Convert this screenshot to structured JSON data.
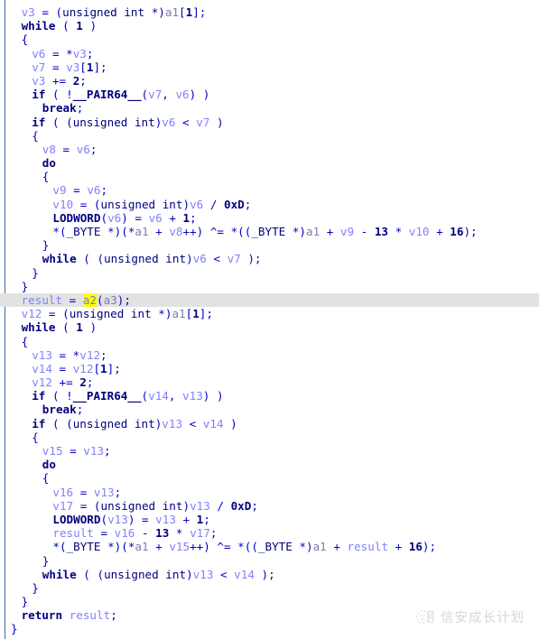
{
  "window": {
    "view_name": "Pseudocode",
    "language": "C"
  },
  "highlight": {
    "selected_token": "a2",
    "selected_line_index": 22,
    "selection_color": "#ffff00",
    "line_color": "#e2e2e2",
    "gutter_rule_color": "#3a6ea5"
  },
  "watermark": {
    "text": "信安成长计划",
    "logo_name": "circular-book-logo"
  },
  "code": {
    "lines": [
      {
        "indent": 1,
        "tokens": [
          {
            "t": "var",
            "v": "v3"
          },
          {
            "t": "punct",
            "v": " = ("
          },
          {
            "t": "type",
            "v": "unsigned int"
          },
          {
            "t": "punct",
            "v": " *)"
          },
          {
            "t": "arg",
            "v": "a1"
          },
          {
            "t": "punct",
            "v": "["
          },
          {
            "t": "num",
            "v": "1"
          },
          {
            "t": "punct",
            "v": "];"
          }
        ]
      },
      {
        "indent": 1,
        "tokens": [
          {
            "t": "kw",
            "v": "while"
          },
          {
            "t": "punct",
            "v": " ( "
          },
          {
            "t": "num",
            "v": "1"
          },
          {
            "t": "punct",
            "v": " )"
          }
        ]
      },
      {
        "indent": 1,
        "tokens": [
          {
            "t": "brace",
            "v": "{"
          }
        ]
      },
      {
        "indent": 2,
        "tokens": [
          {
            "t": "var",
            "v": "v6"
          },
          {
            "t": "punct",
            "v": " = *"
          },
          {
            "t": "var",
            "v": "v3"
          },
          {
            "t": "punct",
            "v": ";"
          }
        ]
      },
      {
        "indent": 2,
        "tokens": [
          {
            "t": "var",
            "v": "v7"
          },
          {
            "t": "punct",
            "v": " = "
          },
          {
            "t": "var",
            "v": "v3"
          },
          {
            "t": "punct",
            "v": "["
          },
          {
            "t": "num",
            "v": "1"
          },
          {
            "t": "punct",
            "v": "];"
          }
        ]
      },
      {
        "indent": 2,
        "tokens": [
          {
            "t": "var",
            "v": "v3"
          },
          {
            "t": "punct",
            "v": " += "
          },
          {
            "t": "num",
            "v": "2"
          },
          {
            "t": "punct",
            "v": ";"
          }
        ]
      },
      {
        "indent": 2,
        "tokens": [
          {
            "t": "kw",
            "v": "if"
          },
          {
            "t": "punct",
            "v": " ( !"
          },
          {
            "t": "func",
            "v": "__PAIR64__"
          },
          {
            "t": "punct",
            "v": "("
          },
          {
            "t": "var",
            "v": "v7"
          },
          {
            "t": "punct",
            "v": ", "
          },
          {
            "t": "var",
            "v": "v6"
          },
          {
            "t": "punct",
            "v": ") )"
          }
        ]
      },
      {
        "indent": 3,
        "tokens": [
          {
            "t": "kw",
            "v": "break"
          },
          {
            "t": "punct",
            "v": ";"
          }
        ]
      },
      {
        "indent": 2,
        "tokens": [
          {
            "t": "kw",
            "v": "if"
          },
          {
            "t": "punct",
            "v": " ( ("
          },
          {
            "t": "type",
            "v": "unsigned int"
          },
          {
            "t": "punct",
            "v": ")"
          },
          {
            "t": "var",
            "v": "v6"
          },
          {
            "t": "punct",
            "v": " < "
          },
          {
            "t": "var",
            "v": "v7"
          },
          {
            "t": "punct",
            "v": " )"
          }
        ]
      },
      {
        "indent": 2,
        "tokens": [
          {
            "t": "brace",
            "v": "{"
          }
        ]
      },
      {
        "indent": 3,
        "tokens": [
          {
            "t": "var",
            "v": "v8"
          },
          {
            "t": "punct",
            "v": " = "
          },
          {
            "t": "var",
            "v": "v6"
          },
          {
            "t": "punct",
            "v": ";"
          }
        ]
      },
      {
        "indent": 3,
        "tokens": [
          {
            "t": "kw",
            "v": "do"
          }
        ]
      },
      {
        "indent": 3,
        "tokens": [
          {
            "t": "brace",
            "v": "{"
          }
        ]
      },
      {
        "indent": 4,
        "tokens": [
          {
            "t": "var",
            "v": "v9"
          },
          {
            "t": "punct",
            "v": " = "
          },
          {
            "t": "var",
            "v": "v6"
          },
          {
            "t": "punct",
            "v": ";"
          }
        ]
      },
      {
        "indent": 4,
        "tokens": [
          {
            "t": "var",
            "v": "v10"
          },
          {
            "t": "punct",
            "v": " = ("
          },
          {
            "t": "type",
            "v": "unsigned int"
          },
          {
            "t": "punct",
            "v": ")"
          },
          {
            "t": "var",
            "v": "v6"
          },
          {
            "t": "punct",
            "v": " / "
          },
          {
            "t": "num",
            "v": "0xD"
          },
          {
            "t": "punct",
            "v": ";"
          }
        ]
      },
      {
        "indent": 4,
        "tokens": [
          {
            "t": "func",
            "v": "LODWORD"
          },
          {
            "t": "punct",
            "v": "("
          },
          {
            "t": "var",
            "v": "v6"
          },
          {
            "t": "punct",
            "v": ") = "
          },
          {
            "t": "var",
            "v": "v6"
          },
          {
            "t": "punct",
            "v": " + "
          },
          {
            "t": "num",
            "v": "1"
          },
          {
            "t": "punct",
            "v": ";"
          }
        ]
      },
      {
        "indent": 4,
        "tokens": [
          {
            "t": "punct",
            "v": "*("
          },
          {
            "t": "type",
            "v": "_BYTE"
          },
          {
            "t": "punct",
            "v": " *)(*"
          },
          {
            "t": "arg",
            "v": "a1"
          },
          {
            "t": "punct",
            "v": " + "
          },
          {
            "t": "var",
            "v": "v8"
          },
          {
            "t": "punct",
            "v": "++) ^= *(("
          },
          {
            "t": "type",
            "v": "_BYTE"
          },
          {
            "t": "punct",
            "v": " *)"
          },
          {
            "t": "arg",
            "v": "a1"
          },
          {
            "t": "punct",
            "v": " + "
          },
          {
            "t": "var",
            "v": "v9"
          },
          {
            "t": "punct",
            "v": " - "
          },
          {
            "t": "num",
            "v": "13"
          },
          {
            "t": "punct",
            "v": " * "
          },
          {
            "t": "var",
            "v": "v10"
          },
          {
            "t": "punct",
            "v": " + "
          },
          {
            "t": "num",
            "v": "16"
          },
          {
            "t": "punct",
            "v": ");"
          }
        ]
      },
      {
        "indent": 3,
        "tokens": [
          {
            "t": "brace",
            "v": "}"
          }
        ]
      },
      {
        "indent": 3,
        "tokens": [
          {
            "t": "kw",
            "v": "while"
          },
          {
            "t": "punct",
            "v": " ( ("
          },
          {
            "t": "type",
            "v": "unsigned int"
          },
          {
            "t": "punct",
            "v": ")"
          },
          {
            "t": "var",
            "v": "v6"
          },
          {
            "t": "punct",
            "v": " < "
          },
          {
            "t": "var",
            "v": "v7"
          },
          {
            "t": "punct",
            "v": " );"
          }
        ]
      },
      {
        "indent": 2,
        "tokens": [
          {
            "t": "brace",
            "v": "}"
          }
        ]
      },
      {
        "indent": 1,
        "tokens": [
          {
            "t": "brace",
            "v": "}"
          }
        ]
      },
      {
        "indent": 1,
        "highlighted": true,
        "tokens": [
          {
            "t": "result",
            "v": "result"
          },
          {
            "t": "punct",
            "v": " = "
          },
          {
            "t": "hl",
            "v": "a2"
          },
          {
            "t": "punct",
            "v": "("
          },
          {
            "t": "arg",
            "v": "a3"
          },
          {
            "t": "punct",
            "v": ");"
          }
        ]
      },
      {
        "indent": 1,
        "tokens": [
          {
            "t": "var",
            "v": "v12"
          },
          {
            "t": "punct",
            "v": " = ("
          },
          {
            "t": "type",
            "v": "unsigned int"
          },
          {
            "t": "punct",
            "v": " *)"
          },
          {
            "t": "arg",
            "v": "a1"
          },
          {
            "t": "punct",
            "v": "["
          },
          {
            "t": "num",
            "v": "1"
          },
          {
            "t": "punct",
            "v": "];"
          }
        ]
      },
      {
        "indent": 1,
        "tokens": [
          {
            "t": "kw",
            "v": "while"
          },
          {
            "t": "punct",
            "v": " ( "
          },
          {
            "t": "num",
            "v": "1"
          },
          {
            "t": "punct",
            "v": " )"
          }
        ]
      },
      {
        "indent": 1,
        "tokens": [
          {
            "t": "brace",
            "v": "{"
          }
        ]
      },
      {
        "indent": 2,
        "tokens": [
          {
            "t": "var",
            "v": "v13"
          },
          {
            "t": "punct",
            "v": " = *"
          },
          {
            "t": "var",
            "v": "v12"
          },
          {
            "t": "punct",
            "v": ";"
          }
        ]
      },
      {
        "indent": 2,
        "tokens": [
          {
            "t": "var",
            "v": "v14"
          },
          {
            "t": "punct",
            "v": " = "
          },
          {
            "t": "var",
            "v": "v12"
          },
          {
            "t": "punct",
            "v": "["
          },
          {
            "t": "num",
            "v": "1"
          },
          {
            "t": "punct",
            "v": "];"
          }
        ]
      },
      {
        "indent": 2,
        "tokens": [
          {
            "t": "var",
            "v": "v12"
          },
          {
            "t": "punct",
            "v": " += "
          },
          {
            "t": "num",
            "v": "2"
          },
          {
            "t": "punct",
            "v": ";"
          }
        ]
      },
      {
        "indent": 2,
        "tokens": [
          {
            "t": "kw",
            "v": "if"
          },
          {
            "t": "punct",
            "v": " ( !"
          },
          {
            "t": "func",
            "v": "__PAIR64__"
          },
          {
            "t": "punct",
            "v": "("
          },
          {
            "t": "var",
            "v": "v14"
          },
          {
            "t": "punct",
            "v": ", "
          },
          {
            "t": "var",
            "v": "v13"
          },
          {
            "t": "punct",
            "v": ") )"
          }
        ]
      },
      {
        "indent": 3,
        "tokens": [
          {
            "t": "kw",
            "v": "break"
          },
          {
            "t": "punct",
            "v": ";"
          }
        ]
      },
      {
        "indent": 2,
        "tokens": [
          {
            "t": "kw",
            "v": "if"
          },
          {
            "t": "punct",
            "v": " ( ("
          },
          {
            "t": "type",
            "v": "unsigned int"
          },
          {
            "t": "punct",
            "v": ")"
          },
          {
            "t": "var",
            "v": "v13"
          },
          {
            "t": "punct",
            "v": " < "
          },
          {
            "t": "var",
            "v": "v14"
          },
          {
            "t": "punct",
            "v": " )"
          }
        ]
      },
      {
        "indent": 2,
        "tokens": [
          {
            "t": "brace",
            "v": "{"
          }
        ]
      },
      {
        "indent": 3,
        "tokens": [
          {
            "t": "var",
            "v": "v15"
          },
          {
            "t": "punct",
            "v": " = "
          },
          {
            "t": "var",
            "v": "v13"
          },
          {
            "t": "punct",
            "v": ";"
          }
        ]
      },
      {
        "indent": 3,
        "tokens": [
          {
            "t": "kw",
            "v": "do"
          }
        ]
      },
      {
        "indent": 3,
        "tokens": [
          {
            "t": "brace",
            "v": "{"
          }
        ]
      },
      {
        "indent": 4,
        "tokens": [
          {
            "t": "var",
            "v": "v16"
          },
          {
            "t": "punct",
            "v": " = "
          },
          {
            "t": "var",
            "v": "v13"
          },
          {
            "t": "punct",
            "v": ";"
          }
        ]
      },
      {
        "indent": 4,
        "tokens": [
          {
            "t": "var",
            "v": "v17"
          },
          {
            "t": "punct",
            "v": " = ("
          },
          {
            "t": "type",
            "v": "unsigned int"
          },
          {
            "t": "punct",
            "v": ")"
          },
          {
            "t": "var",
            "v": "v13"
          },
          {
            "t": "punct",
            "v": " / "
          },
          {
            "t": "num",
            "v": "0xD"
          },
          {
            "t": "punct",
            "v": ";"
          }
        ]
      },
      {
        "indent": 4,
        "tokens": [
          {
            "t": "func",
            "v": "LODWORD"
          },
          {
            "t": "punct",
            "v": "("
          },
          {
            "t": "var",
            "v": "v13"
          },
          {
            "t": "punct",
            "v": ") = "
          },
          {
            "t": "var",
            "v": "v13"
          },
          {
            "t": "punct",
            "v": " + "
          },
          {
            "t": "num",
            "v": "1"
          },
          {
            "t": "punct",
            "v": ";"
          }
        ]
      },
      {
        "indent": 4,
        "tokens": [
          {
            "t": "result",
            "v": "result"
          },
          {
            "t": "punct",
            "v": " = "
          },
          {
            "t": "var",
            "v": "v16"
          },
          {
            "t": "punct",
            "v": " - "
          },
          {
            "t": "num",
            "v": "13"
          },
          {
            "t": "punct",
            "v": " * "
          },
          {
            "t": "var",
            "v": "v17"
          },
          {
            "t": "punct",
            "v": ";"
          }
        ]
      },
      {
        "indent": 4,
        "tokens": [
          {
            "t": "punct",
            "v": "*("
          },
          {
            "t": "type",
            "v": "_BYTE"
          },
          {
            "t": "punct",
            "v": " *)(*"
          },
          {
            "t": "arg",
            "v": "a1"
          },
          {
            "t": "punct",
            "v": " + "
          },
          {
            "t": "var",
            "v": "v15"
          },
          {
            "t": "punct",
            "v": "++) ^= *(("
          },
          {
            "t": "type",
            "v": "_BYTE"
          },
          {
            "t": "punct",
            "v": " *)"
          },
          {
            "t": "arg",
            "v": "a1"
          },
          {
            "t": "punct",
            "v": " + "
          },
          {
            "t": "result",
            "v": "result"
          },
          {
            "t": "punct",
            "v": " + "
          },
          {
            "t": "num",
            "v": "16"
          },
          {
            "t": "punct",
            "v": ");"
          }
        ]
      },
      {
        "indent": 3,
        "tokens": [
          {
            "t": "brace",
            "v": "}"
          }
        ]
      },
      {
        "indent": 3,
        "tokens": [
          {
            "t": "kw",
            "v": "while"
          },
          {
            "t": "punct",
            "v": " ( ("
          },
          {
            "t": "type",
            "v": "unsigned int"
          },
          {
            "t": "punct",
            "v": ")"
          },
          {
            "t": "var",
            "v": "v13"
          },
          {
            "t": "punct",
            "v": " < "
          },
          {
            "t": "var",
            "v": "v14"
          },
          {
            "t": "punct",
            "v": " );"
          }
        ]
      },
      {
        "indent": 2,
        "tokens": [
          {
            "t": "brace",
            "v": "}"
          }
        ]
      },
      {
        "indent": 1,
        "tokens": [
          {
            "t": "brace",
            "v": "}"
          }
        ]
      },
      {
        "indent": 1,
        "tokens": [
          {
            "t": "kw",
            "v": "return"
          },
          {
            "t": "punct",
            "v": " "
          },
          {
            "t": "result",
            "v": "result"
          },
          {
            "t": "punct",
            "v": ";"
          }
        ]
      },
      {
        "indent": 0,
        "tokens": [
          {
            "t": "brace",
            "v": "}"
          }
        ]
      }
    ]
  }
}
